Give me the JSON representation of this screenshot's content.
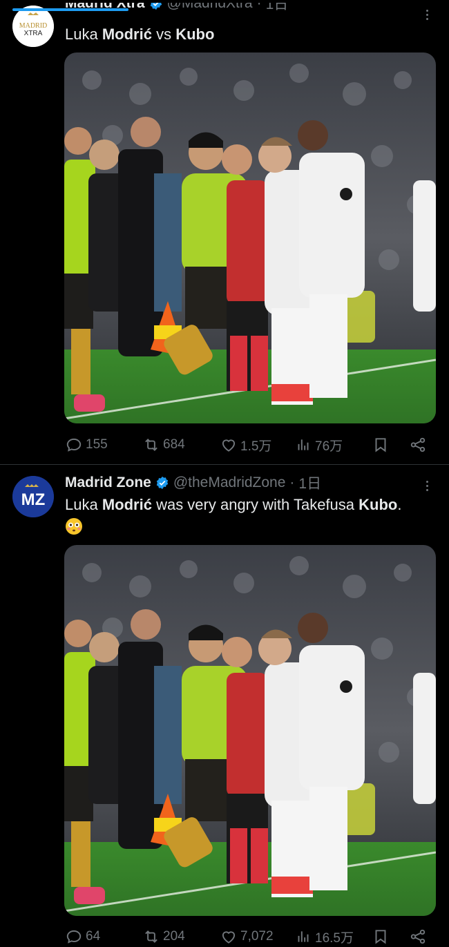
{
  "tweets": [
    {
      "author_name": "Madrid Xtra",
      "handle": "@MadridXtra",
      "time": "1日",
      "avatar_text_top": "MADRID",
      "avatar_text_bottom": "XTRA",
      "text_parts": [
        "Luka ",
        "Modrić",
        " vs ",
        "Kubo"
      ],
      "replies": "155",
      "retweets": "684",
      "likes": "1.5万",
      "views": "76万"
    },
    {
      "author_name": "Madrid Zone",
      "handle": "@theMadridZone",
      "time": "1日",
      "avatar_text": "MZ",
      "text_parts": [
        "Luka ",
        "Modrić",
        " was very angry with Takefusa ",
        "Kubo",
        "."
      ],
      "emoji": "flushed-face",
      "replies": "64",
      "retweets": "204",
      "likes": "7,072",
      "views": "16.5万"
    }
  ],
  "colors": {
    "background": "#000000",
    "text": "#e7e9ea",
    "muted": "#71767b",
    "accent": "#1d9bf0",
    "divider": "#2f3336"
  },
  "icons": [
    "verified-badge-icon",
    "more-icon",
    "reply-icon",
    "retweet-icon",
    "like-icon",
    "views-icon",
    "bookmark-icon",
    "share-icon",
    "flushed-emoji-icon"
  ]
}
